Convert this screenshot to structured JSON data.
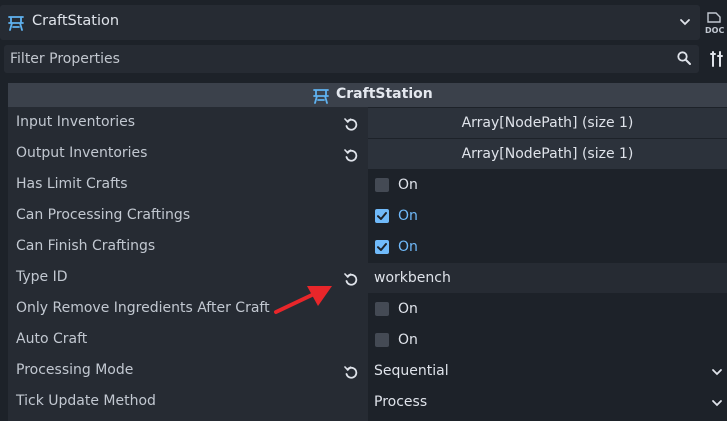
{
  "node": {
    "name": "CraftStation",
    "doc_label": "DOC"
  },
  "filter": {
    "placeholder": "Filter Properties",
    "value": ""
  },
  "section": {
    "title": "CraftStation"
  },
  "properties": [
    {
      "label": "Input Inventories",
      "value": "Array[NodePath] (size 1)"
    },
    {
      "label": "Output Inventories",
      "value": "Array[NodePath] (size 1)"
    },
    {
      "label": "Has Limit Crafts",
      "checked": false,
      "value": "On"
    },
    {
      "label": "Can Processing Craftings",
      "checked": true,
      "value": "On"
    },
    {
      "label": "Can Finish Craftings",
      "checked": true,
      "value": "On"
    },
    {
      "label": "Type ID",
      "value": "workbench"
    },
    {
      "label": "Only Remove Ingredients After Craft",
      "checked": false,
      "value": "On"
    },
    {
      "label": "Auto Craft",
      "checked": false,
      "value": "On"
    },
    {
      "label": "Processing Mode",
      "value": "Sequential"
    },
    {
      "label": "Tick Update Method",
      "value": "Process"
    }
  ],
  "colors": {
    "accent": "#70bafa",
    "annotation_arrow": "#e8262a",
    "icon": "#5fb2f0"
  },
  "icons": [
    "craftstation-node-icon",
    "chevron-down-icon",
    "doc-icon",
    "search-icon",
    "tools-icon",
    "revert-icon",
    "checkbox-icon"
  ]
}
